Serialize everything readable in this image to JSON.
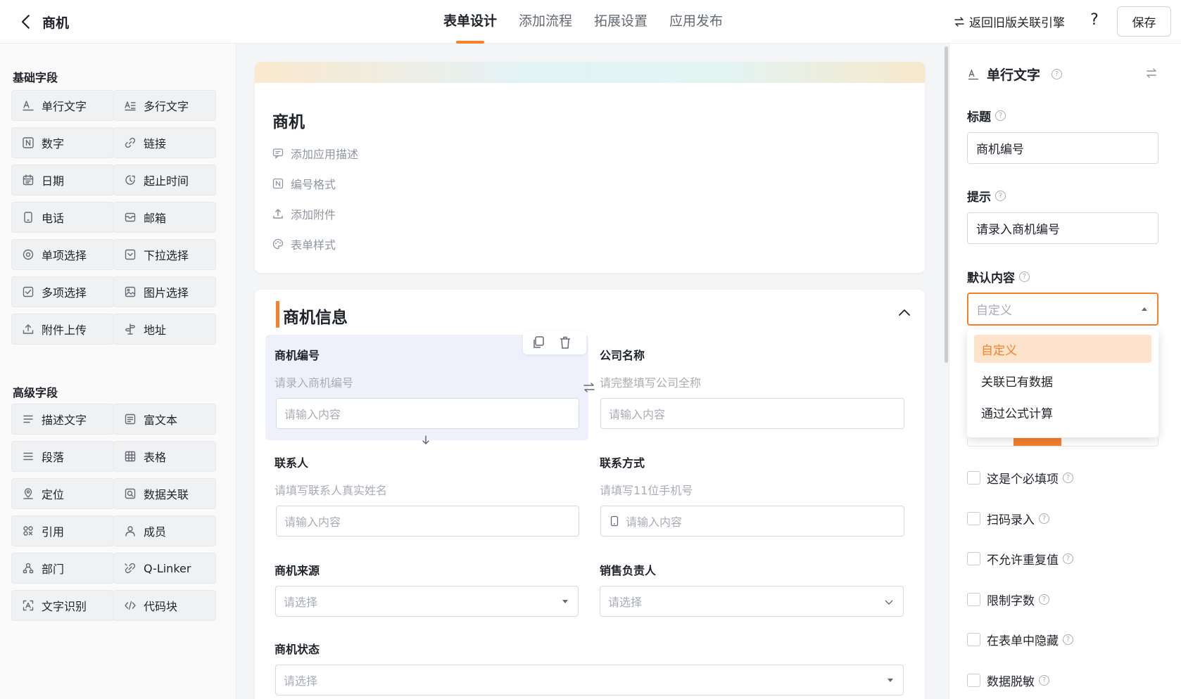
{
  "topbar": {
    "app_name": "商机",
    "tabs": [
      "表单设计",
      "添加流程",
      "拓展设置",
      "应用发布"
    ],
    "active_tab": 0,
    "legacy_link": "返回旧版关联引擎",
    "help": "?",
    "save_label": "保存"
  },
  "left": {
    "basic_title": "基础字段",
    "basic_fields": [
      {
        "label": "单行文字",
        "icon": "single-line-text-icon"
      },
      {
        "label": "多行文字",
        "icon": "multi-line-text-icon"
      },
      {
        "label": "数字",
        "icon": "number-icon"
      },
      {
        "label": "链接",
        "icon": "link-icon"
      },
      {
        "label": "日期",
        "icon": "calendar-icon"
      },
      {
        "label": "起止时间",
        "icon": "clock-range-icon"
      },
      {
        "label": "电话",
        "icon": "phone-icon"
      },
      {
        "label": "邮箱",
        "icon": "mail-icon"
      },
      {
        "label": "单项选择",
        "icon": "radio-icon"
      },
      {
        "label": "下拉选择",
        "icon": "dropdown-icon"
      },
      {
        "label": "多项选择",
        "icon": "checkbox-icon"
      },
      {
        "label": "图片选择",
        "icon": "image-icon"
      },
      {
        "label": "附件上传",
        "icon": "upload-icon"
      },
      {
        "label": "地址",
        "icon": "signpost-icon"
      }
    ],
    "advanced_title": "高级字段",
    "advanced_fields": [
      {
        "label": "描述文字",
        "icon": "description-icon"
      },
      {
        "label": "富文本",
        "icon": "rich-text-icon"
      },
      {
        "label": "段落",
        "icon": "paragraph-icon"
      },
      {
        "label": "表格",
        "icon": "table-icon"
      },
      {
        "label": "定位",
        "icon": "location-icon"
      },
      {
        "label": "数据关联",
        "icon": "data-link-icon"
      },
      {
        "label": "引用",
        "icon": "reference-icon"
      },
      {
        "label": "成员",
        "icon": "member-icon"
      },
      {
        "label": "部门",
        "icon": "department-icon"
      },
      {
        "label": "Q-Linker",
        "icon": "q-linker-icon"
      },
      {
        "label": "文字识别",
        "icon": "ocr-icon"
      },
      {
        "label": "代码块",
        "icon": "code-icon"
      }
    ]
  },
  "header_card": {
    "title": "商机",
    "items": [
      {
        "label": "添加应用描述",
        "icon": "comment-icon"
      },
      {
        "label": "编号格式",
        "icon": "number-format-icon"
      },
      {
        "label": "添加附件",
        "icon": "attachment-upload-icon"
      },
      {
        "label": "表单样式",
        "icon": "palette-icon"
      }
    ]
  },
  "form": {
    "group_title": "商机信息",
    "fields": [
      {
        "label": "商机编号",
        "hint": "请录入商机编号",
        "placeholder": "请输入内容"
      },
      {
        "label": "公司名称",
        "hint": "请完整填写公司全称",
        "placeholder": "请输入内容"
      },
      {
        "label": "联系人",
        "hint": "请填写联系人真实姓名",
        "placeholder": "请输入内容"
      },
      {
        "label": "联系方式",
        "hint": "请填写11位手机号",
        "placeholder": "请输入内容"
      },
      {
        "label": "商机来源",
        "placeholder": "请选择"
      },
      {
        "label": "销售负责人",
        "placeholder": "请选择"
      },
      {
        "label": "商机状态",
        "placeholder": "请选择"
      }
    ]
  },
  "right": {
    "field_type": "单行文字",
    "title_label": "标题",
    "title_value": "商机编号",
    "hint_label": "提示",
    "hint_value": "请录入商机编号",
    "default_label": "默认内容",
    "default_selected": "自定义",
    "default_options": [
      "自定义",
      "关联已有数据",
      "通过公式计算"
    ],
    "checks": [
      "这是个必填项",
      "扫码录入",
      "不允许重复值",
      "限制字数",
      "在表单中隐藏",
      "数据脱敏"
    ],
    "accent": "#f5812b"
  }
}
